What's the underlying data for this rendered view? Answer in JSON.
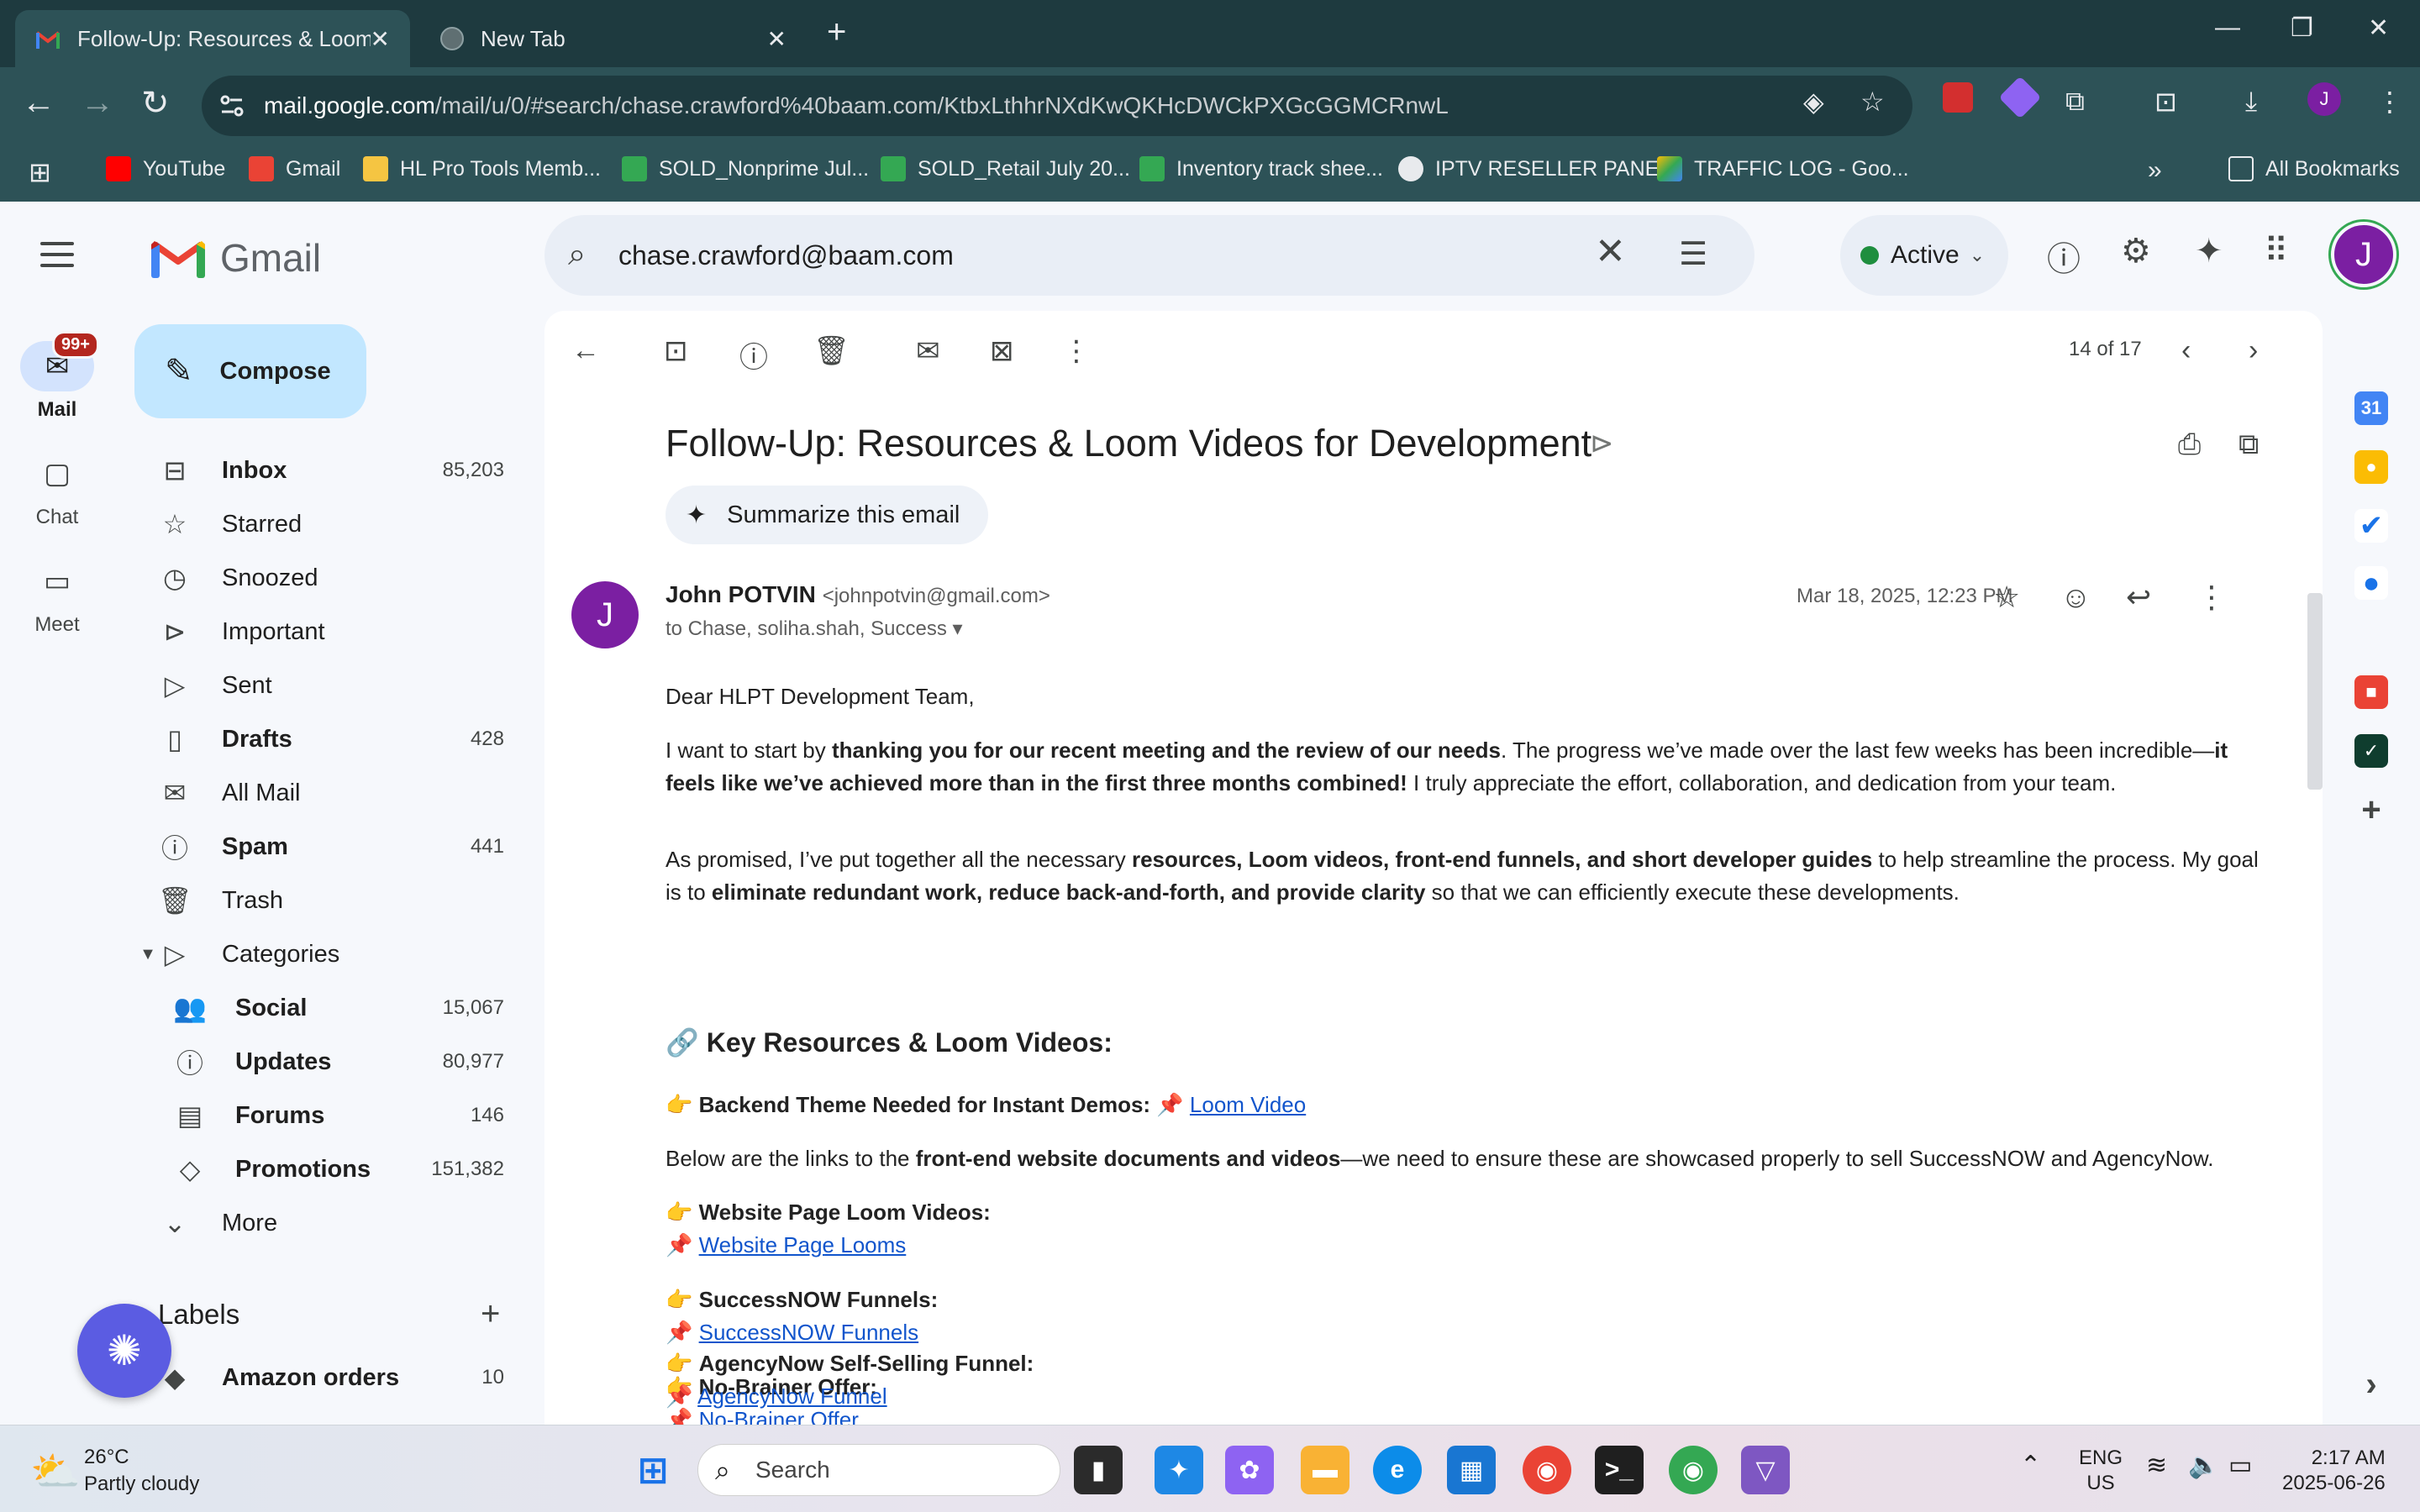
{
  "browser": {
    "tabs": [
      {
        "title": "Follow-Up: Resources & Loom V",
        "active": true
      },
      {
        "title": "New Tab",
        "active": false
      }
    ],
    "new_tab": "+",
    "url_domain": "mail.google.com",
    "url_path": "/mail/u/0/#search/chase.crawford%40baam.com/KtbxLthhrNXdKwQKHcDWCkPXGcGGMCRnwL",
    "profile_initial": "J",
    "bookmarks": [
      "YouTube",
      "Gmail",
      "HL Pro Tools Memb...",
      "SOLD_Nonprime Jul...",
      "SOLD_Retail July 20...",
      "Inventory track shee...",
      "IPTV RESELLER PANEL",
      "TRAFFIC LOG - Goo..."
    ],
    "all_bookmarks": "All Bookmarks"
  },
  "gmail": {
    "logo_text": "Gmail",
    "rail": [
      {
        "label": "Mail",
        "badge": "99+"
      },
      {
        "label": "Chat"
      },
      {
        "label": "Meet"
      }
    ],
    "compose_label": "Compose",
    "nav": [
      {
        "label": "Inbox",
        "count": "85,203"
      },
      {
        "label": "Starred",
        "count": ""
      },
      {
        "label": "Snoozed",
        "count": ""
      },
      {
        "label": "Important",
        "count": ""
      },
      {
        "label": "Sent",
        "count": ""
      },
      {
        "label": "Drafts",
        "count": "428"
      },
      {
        "label": "All Mail",
        "count": ""
      },
      {
        "label": "Spam",
        "count": "441"
      },
      {
        "label": "Trash",
        "count": ""
      },
      {
        "label": "Categories",
        "count": ""
      },
      {
        "label": "Social",
        "count": "15,067"
      },
      {
        "label": "Updates",
        "count": "80,977"
      },
      {
        "label": "Forums",
        "count": "146"
      },
      {
        "label": "Promotions",
        "count": "151,382"
      },
      {
        "label": "More",
        "count": ""
      }
    ],
    "labels_title": "Labels",
    "labels": [
      {
        "label": "Amazon orders",
        "count": "10"
      }
    ],
    "search_value": "chase.crawford@baam.com",
    "status": "Active",
    "user_initial": "J",
    "pager": "14 of 17",
    "email": {
      "subject": "Follow-Up: Resources & Loom Videos for Development",
      "summarize_label": "Summarize this email",
      "sender_initial": "J",
      "sender_name": "John POTVIN",
      "sender_email": "<johnpotvin@gmail.com>",
      "recipients": "to Chase, soliha.shah, Success",
      "date": "Mar 18, 2025, 12:23 PM",
      "greeting": "Dear HLPT Development Team,",
      "p1_a": "I want to start by ",
      "p1_b": "thanking you for our recent meeting and the review of our needs",
      "p1_c": ". The progress we’ve made over the last few weeks has been incredible—",
      "p1_d": "it feels like we’ve achieved more than in the first three months combined!",
      "p1_e": " I truly appreciate the effort, collaboration, and dedication from your team.",
      "p2_a": "As promised, I’ve put together all the necessary ",
      "p2_b": "resources, Loom videos, front-end funnels, and short developer guides",
      "p2_c": " to help streamline the process. My goal is to ",
      "p2_d": "eliminate redundant work, reduce back-and-forth, and provide clarity",
      "p2_e": " so that we can efficiently execute these developments.",
      "section_title": "Key Resources & Loom Videos:",
      "backend_label": "Backend Theme Needed for Instant Demos:",
      "backend_link": "Loom Video",
      "p3_a": "Below are the links to the ",
      "p3_b": "front-end website documents and videos",
      "p3_c": "—we need to ensure these are showcased properly to sell SuccessNOW and AgencyNow.",
      "items": [
        {
          "label": "Website Page Loom Videos:",
          "link": "Website Page Looms"
        },
        {
          "label": "SuccessNOW Funnels:",
          "link": "SuccessNOW Funnels"
        },
        {
          "label": "No-Brainer Offer:",
          "link": "No-Brainer Offer"
        },
        {
          "label": "AgencyNow Self-Selling Funnel:",
          "link": "AgencyNow Funnel"
        }
      ]
    }
  },
  "taskbar": {
    "temp": "26°C",
    "weather": "Partly cloudy",
    "search_placeholder": "Search",
    "lang_1": "ENG",
    "lang_2": "US",
    "time": "2:17 AM",
    "date": "2025-06-26"
  }
}
